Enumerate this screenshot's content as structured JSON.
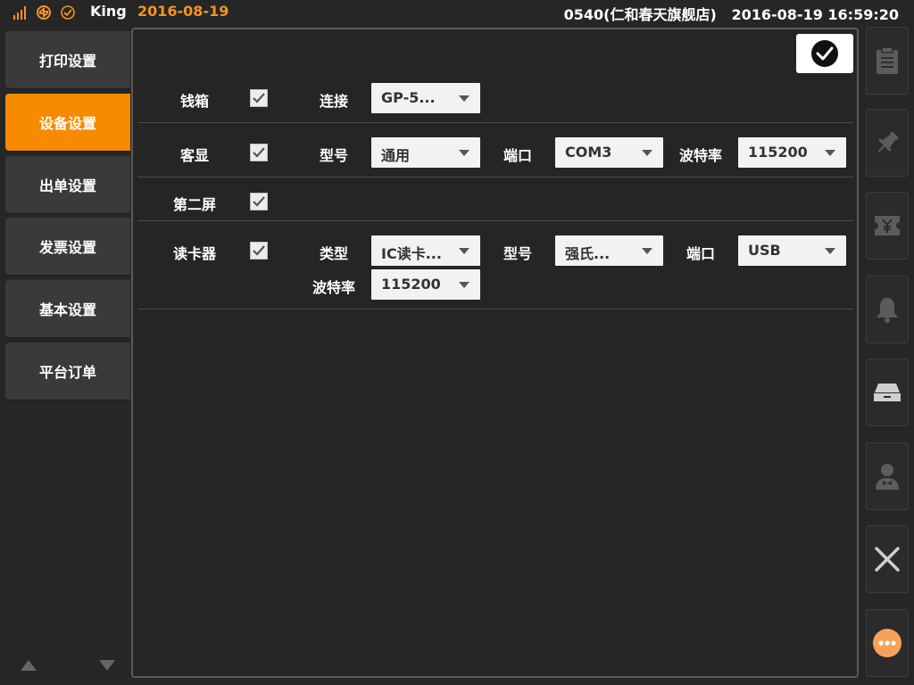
{
  "status": {
    "user": "King",
    "date": "2016-08-19",
    "store": "0540(仁和春天旗舰店)",
    "datetime": "2016-08-19 16:59:20",
    "icons": [
      "signal-icon",
      "sync-icon",
      "check-circle-icon"
    ],
    "accent": "#f7931e"
  },
  "menu": {
    "items": [
      {
        "label": "打印设置",
        "active": false
      },
      {
        "label": "设备设置",
        "active": true
      },
      {
        "label": "出单设置",
        "active": false
      },
      {
        "label": "发票设置",
        "active": false
      },
      {
        "label": "基本设置",
        "active": false
      },
      {
        "label": "平台订单",
        "active": false
      }
    ],
    "active_color": "#f88a00"
  },
  "devices": {
    "cash_drawer": {
      "label": "钱箱",
      "checked": true,
      "connect_label": "连接",
      "connect_value": "GP-5..."
    },
    "customer_display": {
      "label": "客显",
      "checked": true,
      "model_label": "型号",
      "model_value": "通用",
      "port_label": "端口",
      "port_value": "COM3",
      "baud_label": "波特率",
      "baud_value": "115200"
    },
    "second_screen": {
      "label": "第二屏",
      "checked": true
    },
    "card_reader": {
      "label": "读卡器",
      "checked": true,
      "type_label": "类型",
      "type_value": "IC读卡...",
      "model_label": "型号",
      "model_value": "强氏...",
      "port_label": "端口",
      "port_value": "USB",
      "baud_label": "波特率",
      "baud_value": "115200"
    }
  },
  "toolbar": {
    "buttons": [
      "clipboard-icon",
      "pin-icon",
      "yuan-ticket-icon",
      "bell-icon",
      "cash-drawer-icon",
      "waiter-icon",
      "close-icon",
      "more-icon"
    ]
  }
}
